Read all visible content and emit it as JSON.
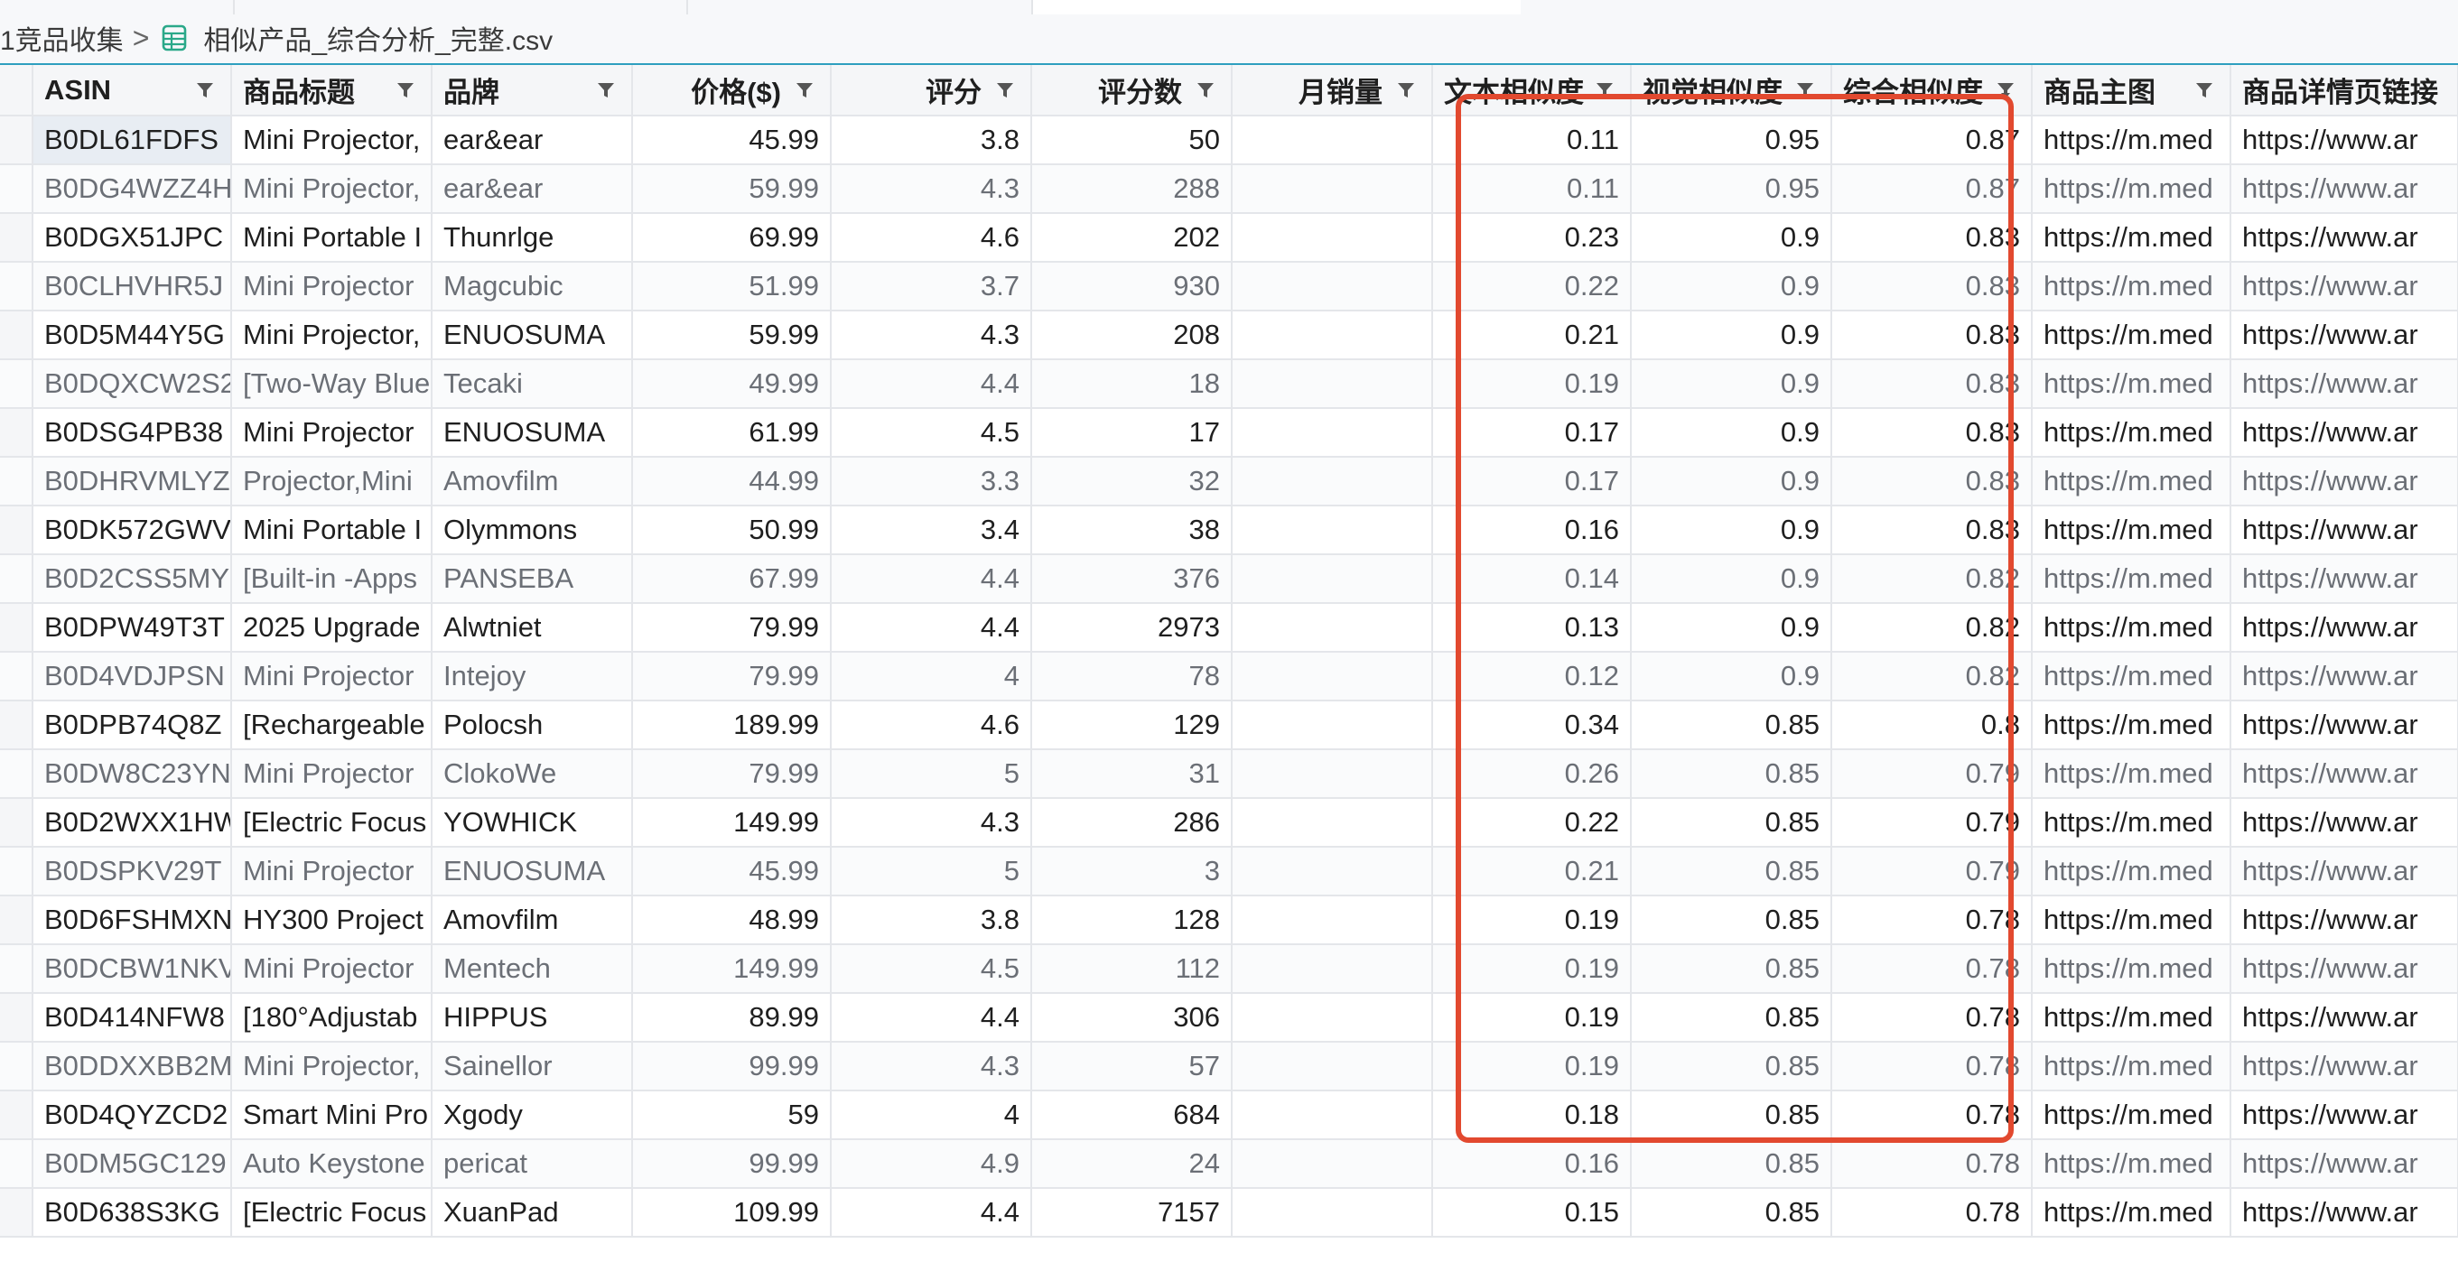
{
  "breadcrumb": {
    "parent": "1竞品收集",
    "separator": ">",
    "file": "相似产品_综合分析_完整.csv"
  },
  "columns": [
    {
      "key": "asin",
      "label": "ASIN",
      "align": "left"
    },
    {
      "key": "title",
      "label": "商品标题",
      "align": "left"
    },
    {
      "key": "brand",
      "label": "品牌",
      "align": "left"
    },
    {
      "key": "price",
      "label": "价格($)",
      "align": "right"
    },
    {
      "key": "rating",
      "label": "评分",
      "align": "right"
    },
    {
      "key": "reviews",
      "label": "评分数",
      "align": "right"
    },
    {
      "key": "monthly_sales",
      "label": "月销量",
      "align": "right"
    },
    {
      "key": "text_sim",
      "label": "文本相似度",
      "align": "right"
    },
    {
      "key": "visual_sim",
      "label": "视觉相似度",
      "align": "right"
    },
    {
      "key": "overall_sim",
      "label": "综合相似度",
      "align": "right"
    },
    {
      "key": "image",
      "label": "商品主图",
      "align": "left"
    },
    {
      "key": "detail_url",
      "label": "商品详情页链接",
      "align": "left"
    }
  ],
  "rows": [
    [
      "B0DL61FDFS",
      "Mini Projector,",
      "ear&ear",
      "45.99",
      "3.8",
      "50",
      "",
      "0.11",
      "0.95",
      "0.87",
      "https://m.med",
      "https://www.ar"
    ],
    [
      "B0DG4WZZ4H",
      "Mini Projector,",
      "ear&ear",
      "59.99",
      "4.3",
      "288",
      "",
      "0.11",
      "0.95",
      "0.87",
      "https://m.med",
      "https://www.ar"
    ],
    [
      "B0DGX51JPC",
      "Mini Portable I",
      "Thunrlge",
      "69.99",
      "4.6",
      "202",
      "",
      "0.23",
      "0.9",
      "0.83",
      "https://m.med",
      "https://www.ar"
    ],
    [
      "B0CLHVHR5J",
      "Mini Projector",
      "Magcubic",
      "51.99",
      "3.7",
      "930",
      "",
      "0.22",
      "0.9",
      "0.83",
      "https://m.med",
      "https://www.ar"
    ],
    [
      "B0D5M44Y5G",
      "Mini Projector,",
      "ENUOSUMA",
      "59.99",
      "4.3",
      "208",
      "",
      "0.21",
      "0.9",
      "0.83",
      "https://m.med",
      "https://www.ar"
    ],
    [
      "B0DQXCW2S2",
      "[Two-Way Blue",
      "Tecaki",
      "49.99",
      "4.4",
      "18",
      "",
      "0.19",
      "0.9",
      "0.83",
      "https://m.med",
      "https://www.ar"
    ],
    [
      "B0DSG4PB38",
      "Mini Projector",
      "ENUOSUMA",
      "61.99",
      "4.5",
      "17",
      "",
      "0.17",
      "0.9",
      "0.83",
      "https://m.med",
      "https://www.ar"
    ],
    [
      "B0DHRVMLYZ",
      "Projector,Mini",
      "Amovfilm",
      "44.99",
      "3.3",
      "32",
      "",
      "0.17",
      "0.9",
      "0.83",
      "https://m.med",
      "https://www.ar"
    ],
    [
      "B0DK572GWV",
      "Mini Portable I",
      "Olymmons",
      "50.99",
      "3.4",
      "38",
      "",
      "0.16",
      "0.9",
      "0.83",
      "https://m.med",
      "https://www.ar"
    ],
    [
      "B0D2CSS5MY",
      "[Built-in -Apps",
      "PANSEBA",
      "67.99",
      "4.4",
      "376",
      "",
      "0.14",
      "0.9",
      "0.82",
      "https://m.med",
      "https://www.ar"
    ],
    [
      "B0DPW49T3T",
      "2025 Upgrade",
      "Alwtniet",
      "79.99",
      "4.4",
      "2973",
      "",
      "0.13",
      "0.9",
      "0.82",
      "https://m.med",
      "https://www.ar"
    ],
    [
      "B0D4VDJPSN",
      "Mini Projector",
      "Intejoy",
      "79.99",
      "4",
      "78",
      "",
      "0.12",
      "0.9",
      "0.82",
      "https://m.med",
      "https://www.ar"
    ],
    [
      "B0DPB74Q8Z",
      "[Rechargeable",
      "Polocsh",
      "189.99",
      "4.6",
      "129",
      "",
      "0.34",
      "0.85",
      "0.8",
      "https://m.med",
      "https://www.ar"
    ],
    [
      "B0DW8C23YN",
      "Mini Projector",
      "ClokoWe",
      "79.99",
      "5",
      "31",
      "",
      "0.26",
      "0.85",
      "0.79",
      "https://m.med",
      "https://www.ar"
    ],
    [
      "B0D2WXX1HW",
      "[Electric Focus",
      "YOWHICK",
      "149.99",
      "4.3",
      "286",
      "",
      "0.22",
      "0.85",
      "0.79",
      "https://m.med",
      "https://www.ar"
    ],
    [
      "B0DSPKV29T",
      "Mini Projector",
      "ENUOSUMA",
      "45.99",
      "5",
      "3",
      "",
      "0.21",
      "0.85",
      "0.79",
      "https://m.med",
      "https://www.ar"
    ],
    [
      "B0D6FSHMXN",
      "HY300 Project",
      "Amovfilm",
      "48.99",
      "3.8",
      "128",
      "",
      "0.19",
      "0.85",
      "0.78",
      "https://m.med",
      "https://www.ar"
    ],
    [
      "B0DCBW1NKV",
      "Mini Projector",
      "Mentech",
      "149.99",
      "4.5",
      "112",
      "",
      "0.19",
      "0.85",
      "0.78",
      "https://m.med",
      "https://www.ar"
    ],
    [
      "B0D414NFW8",
      "[180°Adjustab",
      "HIPPUS",
      "89.99",
      "4.4",
      "306",
      "",
      "0.19",
      "0.85",
      "0.78",
      "https://m.med",
      "https://www.ar"
    ],
    [
      "B0DDXXBB2M",
      "Mini Projector,",
      "Sainellor",
      "99.99",
      "4.3",
      "57",
      "",
      "0.19",
      "0.85",
      "0.78",
      "https://m.med",
      "https://www.ar"
    ],
    [
      "B0D4QYZCD2",
      "Smart Mini Pro",
      "Xgody",
      "59",
      "4",
      "684",
      "",
      "0.18",
      "0.85",
      "0.78",
      "https://m.med",
      "https://www.ar"
    ],
    [
      "B0DM5GC129",
      "Auto Keystone",
      "pericat",
      "99.99",
      "4.9",
      "24",
      "",
      "0.16",
      "0.85",
      "0.78",
      "https://m.med",
      "https://www.ar"
    ],
    [
      "B0D638S3KG",
      "[Electric Focus",
      "XuanPad",
      "109.99",
      "4.4",
      "7157",
      "",
      "0.15",
      "0.85",
      "0.78",
      "https://m.med",
      "https://www.ar"
    ]
  ],
  "icons": {
    "csv": "csv-file-icon",
    "filter": "filter-icon",
    "sort": "sort-desc-icon"
  },
  "colors": {
    "accent": "#2e9fbf",
    "highlight": "#e2492f",
    "csv_icon": "#2aa889"
  }
}
